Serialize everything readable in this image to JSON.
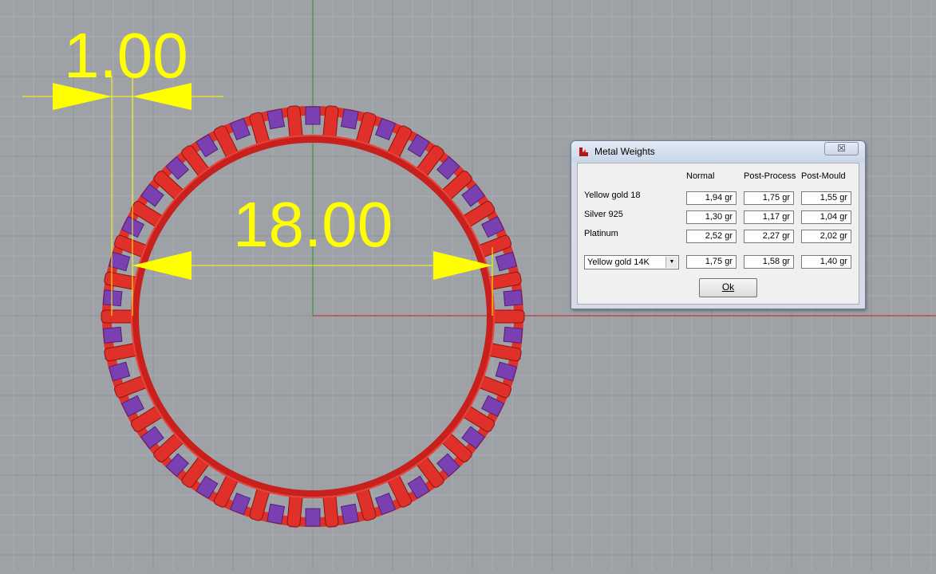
{
  "viewport": {
    "dimension_small": "1.00",
    "dimension_large": "18.00",
    "colors": {
      "background": "#9ea2a6",
      "grid_minor": "#a9adb1",
      "grid_major": "#8f9397",
      "axis_x": "#c81e1e",
      "axis_y": "#1e9a1e",
      "dimension": "#ffff00",
      "ring_metal": "#e0302a",
      "ring_stones": "#7a3fb0"
    }
  },
  "dialog": {
    "title": "Metal Weights",
    "close_label": "☒",
    "columns": [
      "Normal",
      "Post-Process",
      "Post-Mould"
    ],
    "rows": [
      {
        "label": "Yellow gold 18",
        "values": [
          "1,94 gr",
          "1,75 gr",
          "1,55 gr"
        ]
      },
      {
        "label": "Silver 925",
        "values": [
          "1,30 gr",
          "1,17 gr",
          "1,04 gr"
        ]
      },
      {
        "label": "Platinum",
        "values": [
          "2,52 gr",
          "2,27 gr",
          "2,02 gr"
        ]
      }
    ],
    "selected_metal": {
      "label": "Yellow gold 14K",
      "values": [
        "1,75 gr",
        "1,58 gr",
        "1,40 gr"
      ]
    },
    "ok_label": "Ok"
  }
}
